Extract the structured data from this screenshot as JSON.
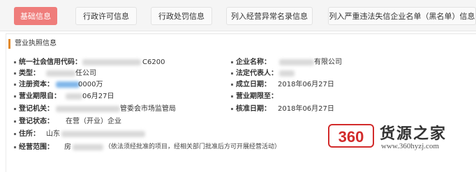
{
  "tabs": [
    {
      "label": "基础信息",
      "active": true
    },
    {
      "label": "行政许可信息",
      "active": false
    },
    {
      "label": "行政处罚信息",
      "active": false
    },
    {
      "label": "列入经营异常名录信息",
      "active": false
    },
    {
      "label": "列入严重违法失信企业名单（黑名单）信息",
      "active": false
    }
  ],
  "section": {
    "title": "营业执照信息"
  },
  "fields": {
    "credit_code": {
      "label": "统一社会信用代码：",
      "value": "C6200"
    },
    "company_name": {
      "label": "企业名称：",
      "value": "有限公司"
    },
    "type": {
      "label": "类型：",
      "value": "任公司"
    },
    "legal_rep": {
      "label": "法定代表人：",
      "value": ""
    },
    "capital": {
      "label": "注册资本：",
      "value": "0000万"
    },
    "established": {
      "label": "成立日期：",
      "value": "2018年06月27日"
    },
    "term_from": {
      "label": "营业期限自：",
      "value": "06月27日"
    },
    "term_to": {
      "label": "营业期限至：",
      "value": ""
    },
    "authority": {
      "label": "登记机关：",
      "value": "管委会市场监管局"
    },
    "approval_date": {
      "label": "核准日期：",
      "value": "2018年06月27日"
    },
    "status": {
      "label": "登记状态：",
      "value": "在营（开业）企业"
    },
    "address": {
      "label": "住所：",
      "value": "山东"
    },
    "scope": {
      "label": "经营范围：",
      "value": "房",
      "note": "（依法须经批准的项目，经相关部门批准后方可开展经营活动）"
    }
  },
  "watermark": {
    "logo": "360",
    "title": "货源之家",
    "url": "www.360hyzj.com"
  },
  "colors": {
    "active_tab": "#ef7d7b",
    "section_bar": "#e28a2c",
    "logo": "#d22b2b"
  }
}
